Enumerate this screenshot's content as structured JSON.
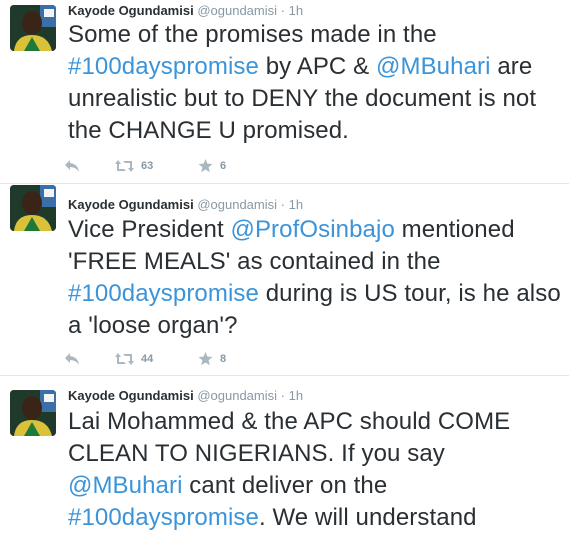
{
  "tweets": [
    {
      "author": "Kayode Ogundamisi",
      "handle": "@ogundamisi",
      "separator": "·",
      "time": "1h",
      "text": [
        {
          "type": "text",
          "value": "Some of the promises made in the "
        },
        {
          "type": "hashtag",
          "value": "#100dayspromise"
        },
        {
          "type": "text",
          "value": " by APC & "
        },
        {
          "type": "mention",
          "value": "@MBuhari"
        },
        {
          "type": "text",
          "value": " are unrealistic but to DENY the document is not the CHANGE U promised."
        }
      ],
      "retweets": "63",
      "favorites": "6"
    },
    {
      "author": "Kayode Ogundamisi",
      "handle": "@ogundamisi",
      "separator": "·",
      "time": "1h",
      "text": [
        {
          "type": "text",
          "value": "Vice President "
        },
        {
          "type": "mention",
          "value": "@ProfOsinbajo"
        },
        {
          "type": "text",
          "value": " mentioned 'FREE MEALS' as contained in the "
        },
        {
          "type": "hashtag",
          "value": "#100dayspromise"
        },
        {
          "type": "text",
          "value": " during is US tour, is he also a 'loose organ'?"
        }
      ],
      "retweets": "44",
      "favorites": "8"
    },
    {
      "author": "Kayode Ogundamisi",
      "handle": "@ogundamisi",
      "separator": "·",
      "time": "1h",
      "text": [
        {
          "type": "text",
          "value": "Lai Mohammed & the APC should COME CLEAN TO NIGERIANS. If you say "
        },
        {
          "type": "mention",
          "value": "@MBuhari"
        },
        {
          "type": "text",
          "value": " cant deliver on the "
        },
        {
          "type": "hashtag",
          "value": "#100dayspromise"
        },
        {
          "type": "text",
          "value": ". We will understand"
        }
      ],
      "retweets": "",
      "favorites": ""
    }
  ],
  "icons": {
    "reply": "reply-icon",
    "retweet": "retweet-icon",
    "favorite": "star-icon"
  },
  "colors": {
    "link": "#3b94d9",
    "muted": "#8899a6",
    "divider": "#e1e8ed",
    "text": "#292f33"
  }
}
